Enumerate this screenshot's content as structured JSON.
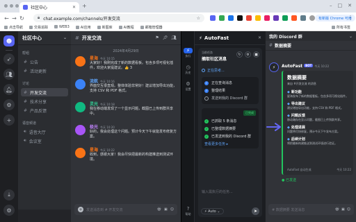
{
  "browser": {
    "tab_title": "社区中心",
    "url": "chat.example.com/channels/开发交流",
    "update_label": "有新版 Chrome 可用",
    "all_bookmarks": "所有书签",
    "bookmarks": [
      "点击导航",
      "交易追踪",
      "WEB3",
      "AI应用",
      "新图库",
      "AI教程",
      "邮箱管理器"
    ]
  },
  "server": {
    "name": "社区中心"
  },
  "channels": {
    "cat1": "帮组",
    "group1": [
      {
        "name": "公告"
      },
      {
        "name": "活动更新"
      }
    ],
    "cat2": "讨论",
    "group2": [
      {
        "name": "开发交流",
        "active": true
      },
      {
        "name": "技术分享"
      },
      {
        "name": "产品反馈"
      }
    ],
    "cat3": "语音频道",
    "group3": [
      {
        "name": "语音大厅"
      },
      {
        "name": "会议室"
      }
    ]
  },
  "chat": {
    "channel": "开发交流",
    "date_divider": "2024年4月29日",
    "input_placeholder": "发送消息到 # 开发交流",
    "messages": [
      {
        "name": "星海",
        "time": "今天 10:15",
        "color": "#f97316",
        "avatar": "#f97316",
        "text": "大家好！我刚完成了新的数据看板。包含多项可视化插件，欢迎大家提建议。👍 3"
      },
      {
        "name": "流航",
        "time": "今天 10:16",
        "color": "#60a5fa",
        "avatar": "#3b82f6",
        "text": "界面交互很直观。整体体验非常好！建议增加导出功能，支持 CSV 和 PDF 格式。"
      },
      {
        "name": "灵光",
        "time": "今天 10:18",
        "color": "#34d399",
        "avatar": "#10b981",
        "text": "我在移动端发现了一个显示问题，截图已上传到群共享中。"
      },
      {
        "name": "极光",
        "time": "今天 10:20",
        "color": "#c084fc",
        "avatar": "#a855f7",
        "text": "好的，我会处理这个问题。预计今天下午就能发布修复方案。"
      },
      {
        "name": "星海",
        "time": "今天 10:22",
        "color": "#f97316",
        "avatar": "#f97316",
        "text": "收到，感谢大家！我会尽快把最新的构建推送到测试环境。"
      }
    ]
  },
  "extension": {
    "title": "AutoFast",
    "rail": [
      {
        "icon": "⚡",
        "label": "执行"
      },
      {
        "icon": "◷",
        "label": "历史"
      },
      {
        "icon": "⚙",
        "label": "设置"
      },
      {
        "icon": "?",
        "label": "帮助"
      }
    ],
    "task_label": "当前任务",
    "task_title": "摘取社区消息",
    "thinking": "正在思考...",
    "steps": [
      {
        "label": "正在查询消息",
        "done": true
      },
      {
        "label": "整理结果",
        "done": true
      },
      {
        "label": "发送到我的 Discord 群",
        "done": false
      }
    ],
    "done_tag": "已完成",
    "done_steps": [
      "已抓取 5 条消息",
      "已整理数据摘要",
      "已发送到我的 Discord 群"
    ],
    "more": "查看更多任务 ▸",
    "input_placeholder": "输入需执行的任务...",
    "model": "Auto"
  },
  "right": {
    "title": "我的 Discord 群",
    "channel": "数据摘要",
    "bot_name": "AutoFast",
    "bot_tag": "BOT",
    "bot_time": "今天 10:22",
    "embed_title": "数据摘要",
    "embed_sub": "来自 #开发交流 的消息",
    "sections": [
      {
        "icon": "◆",
        "head": "新功能",
        "desc": "星海发布了新的数据看板，包含多项可视化插件。"
      },
      {
        "icon": "◆",
        "head": "导出建议",
        "desc": "建议增加导出功能，支持 CSV 和 PDF 格式。"
      },
      {
        "icon": "◆",
        "head": "问题反馈",
        "desc": "移动端存在显示问题，截图已上传到群共享。"
      },
      {
        "icon": "◆",
        "head": "处理进展",
        "desc": "问题将尽快修复，预计今天下午发布方案。"
      },
      {
        "icon": "◆",
        "head": "后续计划",
        "desc": "将把最新构建推送到测试环境进行验证。"
      }
    ],
    "embed_footer": "AutoFast 自动生成",
    "embed_footer_time": "今天 10:22",
    "sent": "● 已发送",
    "input_placeholder": "# 数据摘要 发送消息"
  }
}
